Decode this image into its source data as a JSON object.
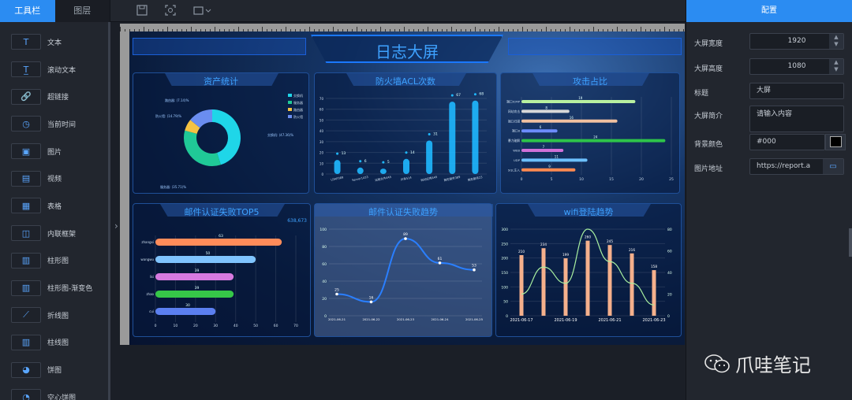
{
  "left_panel": {
    "tabs": [
      {
        "label": "工具栏",
        "active": true
      },
      {
        "label": "图层",
        "active": false
      }
    ],
    "tools": [
      {
        "icon": "text-icon",
        "glyph": "T",
        "label": "文本"
      },
      {
        "icon": "scroll-text-icon",
        "glyph": "T̲",
        "label": "滚动文本"
      },
      {
        "icon": "link-icon",
        "glyph": "🔗",
        "label": "超链接"
      },
      {
        "icon": "clock-icon",
        "glyph": "◷",
        "label": "当前时间"
      },
      {
        "icon": "image-icon",
        "glyph": "▣",
        "label": "图片"
      },
      {
        "icon": "video-icon",
        "glyph": "▤",
        "label": "视频"
      },
      {
        "icon": "table-icon",
        "glyph": "▦",
        "label": "表格"
      },
      {
        "icon": "iframe-icon",
        "glyph": "◫",
        "label": "内联框架"
      },
      {
        "icon": "bar-chart-icon",
        "glyph": "▥",
        "label": "柱形图"
      },
      {
        "icon": "gradient-bar-chart-icon",
        "glyph": "▥",
        "label": "柱形图-渐变色"
      },
      {
        "icon": "line-chart-icon",
        "glyph": "⟋",
        "label": "折线图"
      },
      {
        "icon": "bar-line-chart-icon",
        "glyph": "▥",
        "label": "柱线图"
      },
      {
        "icon": "pie-chart-icon",
        "glyph": "◕",
        "label": "饼图"
      },
      {
        "icon": "donut-chart-icon",
        "glyph": "◔",
        "label": "空心饼图"
      }
    ]
  },
  "toolbar": {
    "icons": [
      "save-icon",
      "screenshot-icon",
      "export-dropdown-icon"
    ]
  },
  "screen": {
    "title": "日志大屏",
    "panels": {
      "assets": "资产统计",
      "firewall": "防火墙ACL次数",
      "attack": "攻击占比",
      "mail": "邮件认证失败TOP5",
      "mail_trend": "邮件认证失败趋势",
      "wifi": "wifi登陆趋势"
    },
    "mail_total": "638,673"
  },
  "right_panel": {
    "header": "配置",
    "fields": {
      "width_label": "大屏宽度",
      "width_value": "1920",
      "height_label": "大屏高度",
      "height_value": "1080",
      "title_label": "标题",
      "title_value": "大屏",
      "desc_label": "大屏简介",
      "desc_placeholder": "请输入内容",
      "bg_label": "背景颜色",
      "bg_value": "#000",
      "image_label": "图片地址",
      "image_value": "https://report.a"
    }
  },
  "watermark": "爪哇笔记",
  "chart_data": [
    {
      "type": "pie",
      "title": "资产统计",
      "labels": [
        "交换机",
        "服务器",
        "路由器",
        "防火墙"
      ],
      "label_texts": [
        "交换机: (47.36)%",
        "服务器: (35.71)%",
        "防火墙: (14.79)%",
        "路由器: (7.14)%"
      ],
      "values": [
        47.36,
        35.71,
        7.14,
        14.79
      ],
      "colors": [
        "#1fd6e8",
        "#20c997",
        "#f5c242",
        "#6a8df0"
      ]
    },
    {
      "type": "bar",
      "title": "防火墙ACL次数",
      "categories": [
        "LDAP389",
        "Server1433",
        "远程文件445",
        "共享514",
        "网站应用445",
        "高危服务389",
        "高危服务23"
      ],
      "values": [
        13,
        6,
        5,
        14,
        31,
        67,
        68
      ],
      "ylim": [
        0,
        70
      ]
    },
    {
      "type": "bar",
      "title": "攻击占比",
      "categories": [
        "端口ICMP",
        "网站攻击",
        "端口扫描",
        "端口8",
        "暴力破解",
        "WEB",
        "UDP",
        "SQL注入"
      ],
      "values": [
        19,
        8,
        16,
        6,
        24,
        7,
        11,
        9
      ],
      "colors": [
        "#b8f0a0",
        "#d8d8d8",
        "#f0c0a0",
        "#6c8cff",
        "#2ec44a",
        "#d070d8",
        "#6cc0ff",
        "#ff8a50"
      ],
      "xlim": [
        0,
        25
      ]
    },
    {
      "type": "bar",
      "title": "邮件认证失败TOP5",
      "categories": [
        "zhangxi",
        "wangwu",
        "lisi",
        "zhao",
        "cui"
      ],
      "values": [
        63,
        50,
        39,
        39,
        30
      ],
      "xlim": [
        0,
        70
      ]
    },
    {
      "type": "line",
      "title": "邮件认证失败趋势",
      "x": [
        "2021-06-21",
        "2021-06-22",
        "2021-06-23",
        "2021-06-24",
        "2021-06-25"
      ],
      "values": [
        25,
        16,
        89,
        61,
        53
      ],
      "ylim": [
        0,
        100
      ]
    },
    {
      "type": "bar",
      "title": "wifi登陆趋势",
      "x": [
        "2021-06-17",
        "2021-06-18",
        "2021-06-19",
        "2021-06-20",
        "2021-06-21",
        "2021-06-22",
        "2021-06-23"
      ],
      "values": [
        210,
        234,
        199,
        260,
        245,
        216,
        158
      ],
      "line": [
        20,
        45,
        30,
        80,
        50,
        30,
        10
      ],
      "ylim": [
        0,
        300
      ],
      "y2lim": [
        0,
        80
      ]
    }
  ]
}
